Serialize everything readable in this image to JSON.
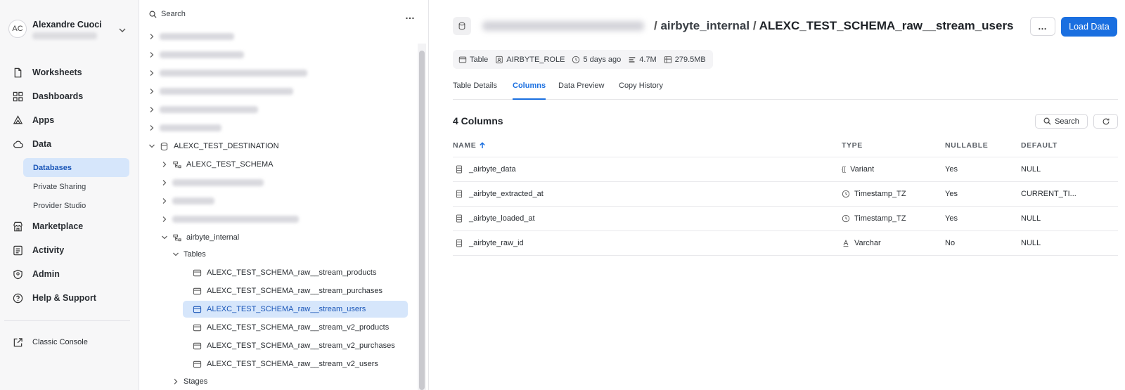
{
  "user": {
    "initials": "AC",
    "name": "Alexandre Cuoci"
  },
  "nav": {
    "items": [
      {
        "label": "Worksheets",
        "icon": "file-icon"
      },
      {
        "label": "Dashboards",
        "icon": "dashboard-icon"
      },
      {
        "label": "Apps",
        "icon": "apps-icon"
      },
      {
        "label": "Data",
        "icon": "cloud-icon"
      }
    ],
    "data_sub": [
      "Databases",
      "Private Sharing",
      "Provider Studio"
    ],
    "items2": [
      {
        "label": "Marketplace",
        "icon": "store-icon"
      },
      {
        "label": "Activity",
        "icon": "activity-icon"
      },
      {
        "label": "Admin",
        "icon": "shield-icon"
      },
      {
        "label": "Help & Support",
        "icon": "help-icon"
      }
    ],
    "classic": "Classic Console"
  },
  "tree": {
    "search_label": "Search",
    "more": "…",
    "destination": "ALEXC_TEST_DESTINATION",
    "schema1": "ALEXC_TEST_SCHEMA",
    "schema2": "airbyte_internal",
    "tables_label": "Tables",
    "tables": [
      "ALEXC_TEST_SCHEMA_raw__stream_products",
      "ALEXC_TEST_SCHEMA_raw__stream_purchases",
      "ALEXC_TEST_SCHEMA_raw__stream_users",
      "ALEXC_TEST_SCHEMA_raw__stream_v2_products",
      "ALEXC_TEST_SCHEMA_raw__stream_v2_purchases",
      "ALEXC_TEST_SCHEMA_raw__stream_v2_users"
    ],
    "selected_index": 2,
    "stages_label": "Stages"
  },
  "header": {
    "schema": "airbyte_internal",
    "table": "ALEXC_TEST_SCHEMA_raw__stream_users",
    "sep": "/",
    "more": "…",
    "load_data": "Load Data"
  },
  "meta": {
    "kind": "Table",
    "role": "AIRBYTE_ROLE",
    "age": "5 days ago",
    "rows": "4.7M",
    "size": "279.5MB"
  },
  "tabs": [
    "Table Details",
    "Columns",
    "Data Preview",
    "Copy History"
  ],
  "active_tab": "Columns",
  "columns_view": {
    "count_label": "4 Columns",
    "search_label": "Search",
    "headers": {
      "name": "NAME",
      "type": "TYPE",
      "nullable": "NULLABLE",
      "default": "DEFAULT"
    },
    "rows": [
      {
        "name": "_airbyte_data",
        "type": "Variant",
        "type_icon": "variant-icon",
        "nullable": "Yes",
        "default": "NULL"
      },
      {
        "name": "_airbyte_extracted_at",
        "type": "Timestamp_TZ",
        "type_icon": "clock-icon",
        "nullable": "Yes",
        "default": "CURRENT_TI..."
      },
      {
        "name": "_airbyte_loaded_at",
        "type": "Timestamp_TZ",
        "type_icon": "clock-icon",
        "nullable": "Yes",
        "default": "NULL"
      },
      {
        "name": "_airbyte_raw_id",
        "type": "Varchar",
        "type_icon": "text-type-icon",
        "nullable": "No",
        "default": "NULL"
      }
    ]
  },
  "colors": {
    "accent": "#1a6fe0",
    "selected_bg": "#d6e6fb"
  }
}
